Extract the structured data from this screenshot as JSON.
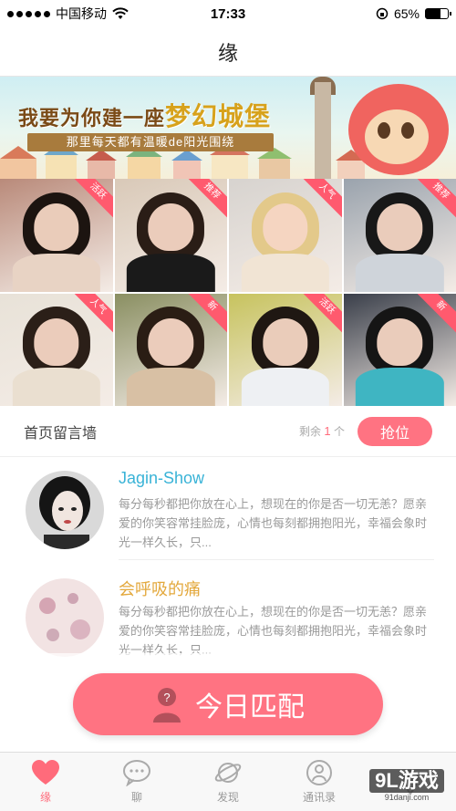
{
  "status_bar": {
    "carrier": "中国移动",
    "time": "17:33",
    "battery": "65%",
    "battery_level": 0.65,
    "signal_icon": "signal-dots-icon",
    "wifi_icon": "wifi-icon",
    "lock_icon": "orientation-lock-icon"
  },
  "nav": {
    "title": "缘"
  },
  "banner": {
    "title_prefix": "我要为你建一座",
    "title_emphasis": "梦幻城堡",
    "subtitle": "那里每天都有温暖de阳光围绕"
  },
  "photos": [
    {
      "tag": "活跃",
      "hair": "#1c1410",
      "body": "#e8d3c4",
      "bg": "#b98a7a"
    },
    {
      "tag": "推荐",
      "hair": "#2a1d16",
      "body": "#1a1a1a",
      "bg": "#d9c9b8"
    },
    {
      "tag": "人气",
      "hair": "#e3c98a",
      "body": "#f1e4d4",
      "bg": "#d7d3cf"
    },
    {
      "tag": "推荐",
      "hair": "#181818",
      "body": "#cfd4da",
      "bg": "#9aa3ad"
    },
    {
      "tag": "人气",
      "hair": "#2b1f18",
      "body": "#eadfd0",
      "bg": "#e8e2d8"
    },
    {
      "tag": "新",
      "hair": "#2a1d14",
      "body": "#d8c0a4",
      "bg": "#8a8f62"
    },
    {
      "tag": "活跃",
      "hair": "#1f1712",
      "body": "#eef0f3",
      "bg": "#c7c35e"
    },
    {
      "tag": "新",
      "hair": "#151515",
      "body": "#3fb5c2",
      "bg": "#3a3f4a"
    }
  ],
  "wall": {
    "title": "首页留言墙",
    "remain_prefix": "剩余",
    "remain_count": "1",
    "remain_suffix": "个",
    "grab_label": "抢位"
  },
  "messages": [
    {
      "name": "Jagin-Show",
      "name_color": "#39b3d7",
      "text": "每分每秒都把你放在心上，想现在的你是否一切无恙？愿亲爱的你笑容常挂脸庞，心情也每刻都拥抱阳光，幸福会象时光一样久长，只..."
    },
    {
      "name": "会呼吸的痛",
      "name_color": "#e3a83c",
      "text": "每分每秒都把你放在心上，想现在的你是否一切无恙？愿亲爱的你笑容常挂脸庞，心情也每刻都拥抱阳光，幸福会象时光一样久长，只..."
    }
  ],
  "match": {
    "label": "今日匹配",
    "icon": "question-person-icon"
  },
  "tabs": [
    {
      "label": "缘",
      "icon": "heart-icon",
      "active": true
    },
    {
      "label": "聊",
      "icon": "chat-bubble-icon",
      "active": false
    },
    {
      "label": "发现",
      "icon": "planet-icon",
      "active": false
    },
    {
      "label": "通讯录",
      "icon": "contacts-icon",
      "active": false
    },
    {
      "label": "",
      "icon": "location-pin-icon",
      "active": false
    }
  ],
  "watermark": {
    "logo": "9L游戏",
    "url": "91danji.com"
  },
  "colors": {
    "accent": "#ff7382",
    "tag": "#ff5a6e"
  }
}
